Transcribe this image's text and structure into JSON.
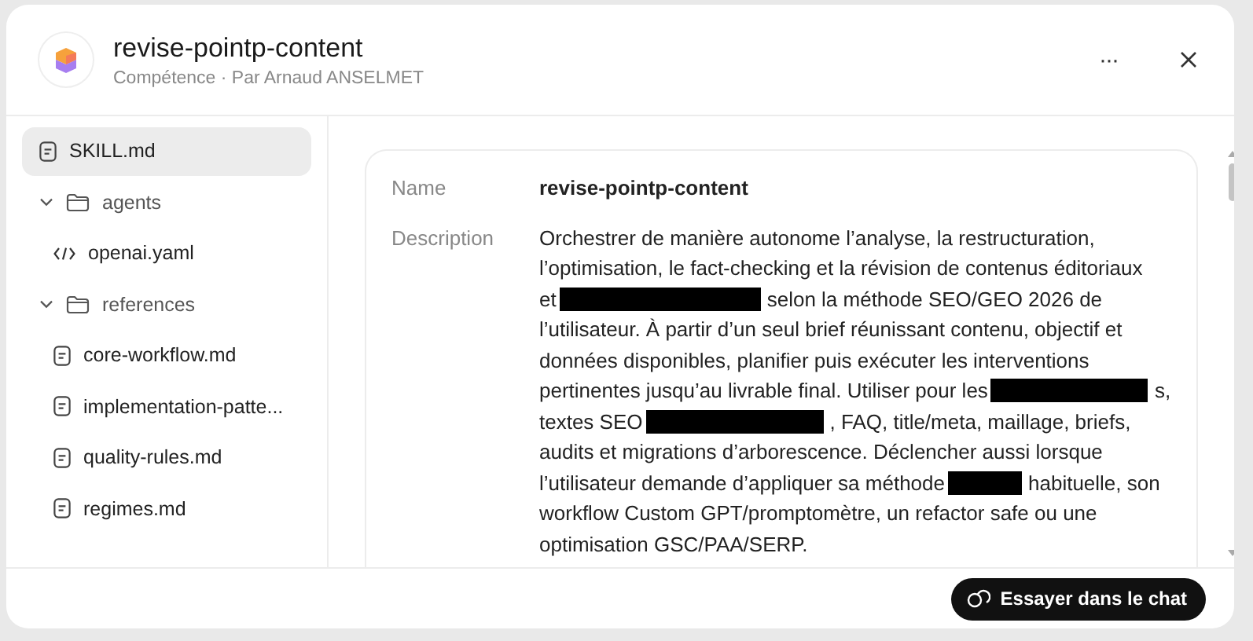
{
  "header": {
    "title": "revise-pointp-content",
    "subtitle": "Compétence · Par Arnaud ANSELMET",
    "more_button": "···"
  },
  "sidebar": {
    "items": [
      {
        "kind": "file",
        "label": "SKILL.md",
        "selected": true
      },
      {
        "kind": "folder",
        "label": "agents",
        "selected": false,
        "expanded": true,
        "children": [
          {
            "kind": "code",
            "label": "openai.yaml",
            "selected": false
          }
        ]
      },
      {
        "kind": "folder",
        "label": "references",
        "selected": false,
        "expanded": true,
        "children": [
          {
            "kind": "file",
            "label": "core-workflow.md",
            "selected": false
          },
          {
            "kind": "file",
            "label": "implementation-patte...",
            "selected": false
          },
          {
            "kind": "file",
            "label": "quality-rules.md",
            "selected": false
          },
          {
            "kind": "file",
            "label": "regimes.md",
            "selected": false
          }
        ]
      }
    ]
  },
  "details": {
    "fields": [
      {
        "label": "Name",
        "kind": "name",
        "lines": [
          [
            {
              "kind": "text",
              "text": "revise-pointp-content"
            }
          ]
        ]
      },
      {
        "label": "Description",
        "kind": "text",
        "lines": [
          [
            {
              "kind": "text",
              "text": "Orchestrer de manière autonome l’analyse, la restructuration,"
            }
          ],
          [
            {
              "kind": "text",
              "text": "l’optimisation, le fact-checking et la révision de contenus éditoriaux"
            }
          ],
          [
            {
              "kind": "text",
              "text": "et"
            },
            {
              "kind": "redacted"
            },
            {
              "kind": "text",
              "text": "selon la méthode SEO/GEO 2026 de"
            }
          ],
          [
            {
              "kind": "text",
              "text": "l’utilisateur. À partir d’un seul brief réunissant contenu, objectif et"
            }
          ],
          [
            {
              "kind": "text",
              "text": "données disponibles, planifier puis exécuter les interventions"
            }
          ],
          [
            {
              "kind": "text",
              "text": "pertinentes jusqu’au livrable final. Utiliser pour les"
            },
            {
              "kind": "redacted"
            },
            {
              "kind": "text",
              "text": "s,"
            }
          ],
          [
            {
              "kind": "text",
              "text": "textes SEO"
            },
            {
              "kind": "redacted"
            },
            {
              "kind": "text",
              "text": ", FAQ, title/meta, maillage, briefs,"
            }
          ],
          [
            {
              "kind": "text",
              "text": "audits et migrations d’arborescence. Déclencher aussi lorsque"
            }
          ],
          [
            {
              "kind": "text",
              "text": "l’utilisateur demande d’appliquer sa méthode"
            },
            {
              "kind": "redacted"
            },
            {
              "kind": "text",
              "text": "habituelle, son"
            }
          ],
          [
            {
              "kind": "text",
              "text": "workflow Custom GPT/promptomètre, un refactor safe ou une"
            }
          ],
          [
            {
              "kind": "text",
              "text": "optimisation GSC/PAA/SERP."
            }
          ]
        ]
      }
    ]
  },
  "footer": {
    "button": "Essayer dans le chat"
  }
}
